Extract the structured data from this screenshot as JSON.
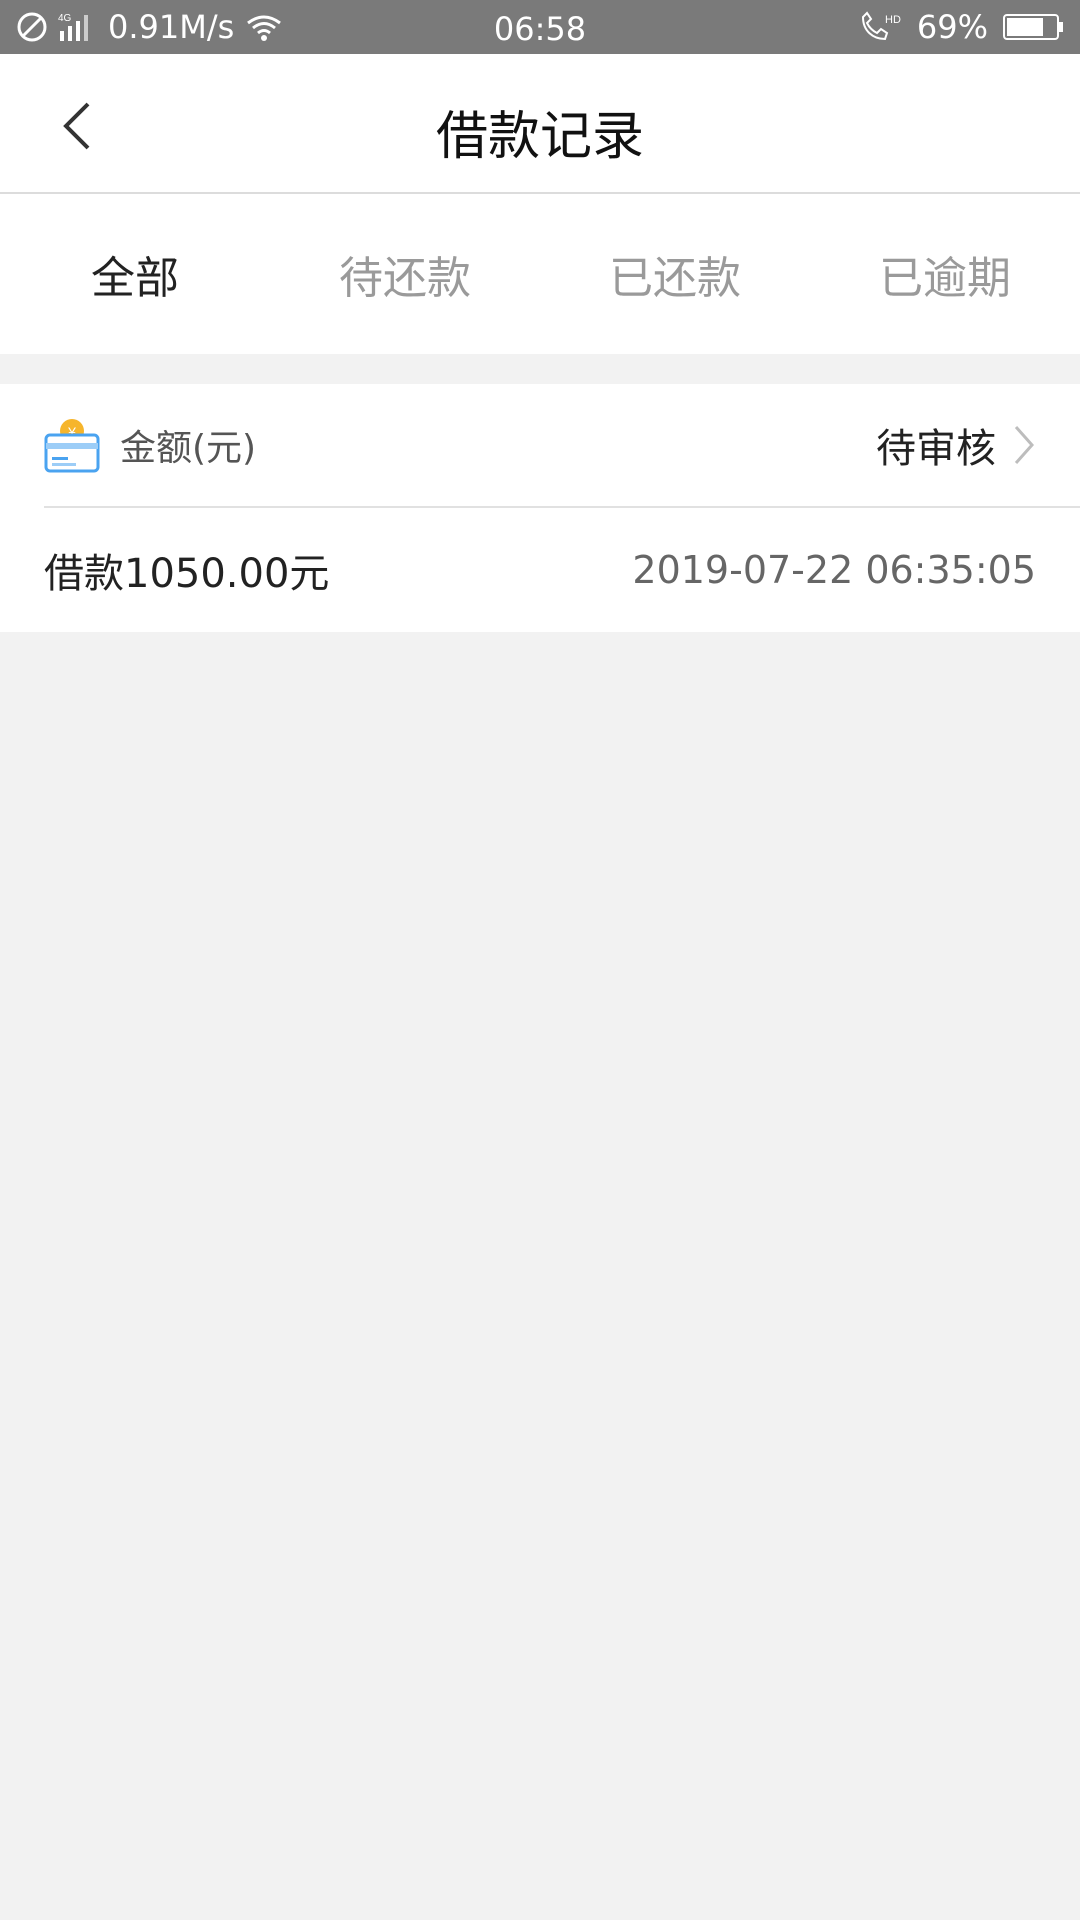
{
  "status_bar": {
    "speed": "0.91M/s",
    "time": "06:58",
    "battery": "69%",
    "icons": [
      "do-not-disturb-icon",
      "signal-4g-icon",
      "wifi-icon",
      "hd-call-icon",
      "battery-icon"
    ]
  },
  "header": {
    "title": "借款记录",
    "back_icon": "back-icon"
  },
  "tabs": [
    {
      "label": "全部",
      "active": true
    },
    {
      "label": "待还款",
      "active": false
    },
    {
      "label": "已还款",
      "active": false
    },
    {
      "label": "已逾期",
      "active": false
    }
  ],
  "record": {
    "amount_label": "金额(元)",
    "status": "待审核",
    "loan_text": "借款1050.00元",
    "datetime": "2019-07-22 06:35:05"
  },
  "colors": {
    "accent_yellow": "#f6b52b",
    "accent_blue": "#4aa3f0",
    "background": "#f2f2f2"
  }
}
